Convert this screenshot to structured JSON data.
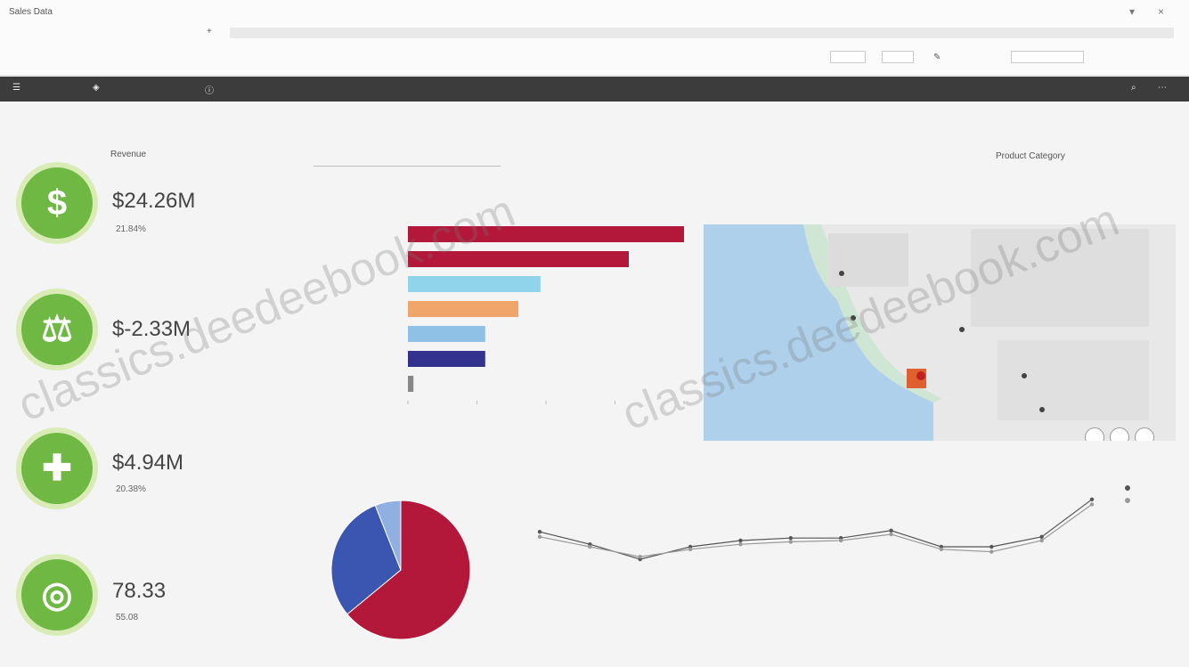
{
  "window": {
    "title": "Sales Data",
    "tab_left": "",
    "tab_active": "",
    "tool_left": "",
    "tool_mid": "",
    "tool_path": "",
    "zoom_options": [
      "",
      ""
    ],
    "right_tools": [
      "",
      "",
      "",
      ""
    ]
  },
  "appbar": {
    "title": "",
    "right_icons": [
      "",
      ""
    ]
  },
  "breadcrumb": "",
  "kpis": [
    {
      "label": "Revenue",
      "sub": "",
      "value": "$24.26M",
      "note": "21.84%",
      "note_muted": "",
      "icon": "dollar-icon",
      "glyph": "$"
    },
    {
      "label": "",
      "sub": "",
      "value": "$-2.33M",
      "note": "",
      "note_muted": "",
      "icon": "scale-icon",
      "glyph": "⚖"
    },
    {
      "label": "",
      "sub": "",
      "value": "$4.94M",
      "note": "20.38%",
      "note_muted": "",
      "icon": "plus-icon",
      "glyph": "✚"
    },
    {
      "label": "",
      "sub": "",
      "value": "78.33",
      "note": "55.08",
      "note_muted": "",
      "icon": "target-icon",
      "glyph": "◎"
    }
  ],
  "slicers": {
    "left": "",
    "mid": "",
    "right": "Product Category"
  },
  "chart_data": [
    {
      "type": "bar",
      "orientation": "horizontal",
      "title": "",
      "subtitle": "",
      "categories": [
        "",
        "",
        "",
        "",
        "",
        "",
        ""
      ],
      "values": [
        100,
        80,
        48,
        40,
        28,
        28,
        2
      ],
      "colors": [
        "#b3173a",
        "#b3173a",
        "#8fd4ea",
        "#f0a56a",
        "#8fc0e6",
        "#33338f",
        "#888888"
      ],
      "xlim": [
        0,
        100
      ],
      "xticks": [
        "",
        "",
        "",
        "",
        ""
      ]
    },
    {
      "type": "pie",
      "title": "",
      "subtitle": "",
      "values": [
        64,
        30,
        6
      ],
      "colors": [
        "#b3173a",
        "#3a56b0",
        "#8fb0e0"
      ],
      "labels": [
        "",
        "",
        ""
      ]
    },
    {
      "type": "line",
      "title": "",
      "subtitle": "",
      "x": [
        "",
        "",
        "",
        "",
        "",
        "",
        "",
        "",
        "",
        "",
        "",
        ""
      ],
      "series": [
        {
          "name": "",
          "values": [
            62,
            52,
            40,
            50,
            55,
            57,
            57,
            63,
            50,
            50,
            58,
            88
          ],
          "color": "#555555"
        },
        {
          "name": "",
          "values": [
            58,
            50,
            42,
            48,
            52,
            54,
            55,
            60,
            48,
            46,
            55,
            84
          ],
          "color": "#9a9a9a"
        }
      ],
      "ylim": [
        0,
        100
      ],
      "yticks": [
        "",
        "",
        ""
      ],
      "legend": "top-right"
    }
  ],
  "map": {
    "title": "",
    "subtitle": "",
    "labels": [
      "",
      "",
      ""
    ],
    "controls": [
      "",
      "",
      ""
    ]
  }
}
